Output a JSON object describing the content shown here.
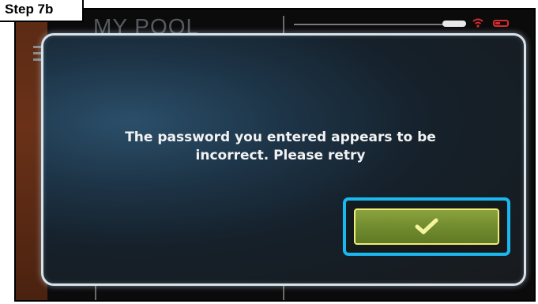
{
  "step_label": "Step 7b",
  "background_app": {
    "title": "MY POOL"
  },
  "dialog": {
    "message": "The password you entered appears to be incorrect. Please retry",
    "confirm_icon": "check-icon"
  },
  "colors": {
    "highlight": "#1ab8f0",
    "confirm_button": "#7a9634",
    "confirm_border": "#f0ec7a",
    "status_alert": "#d62b2b"
  }
}
